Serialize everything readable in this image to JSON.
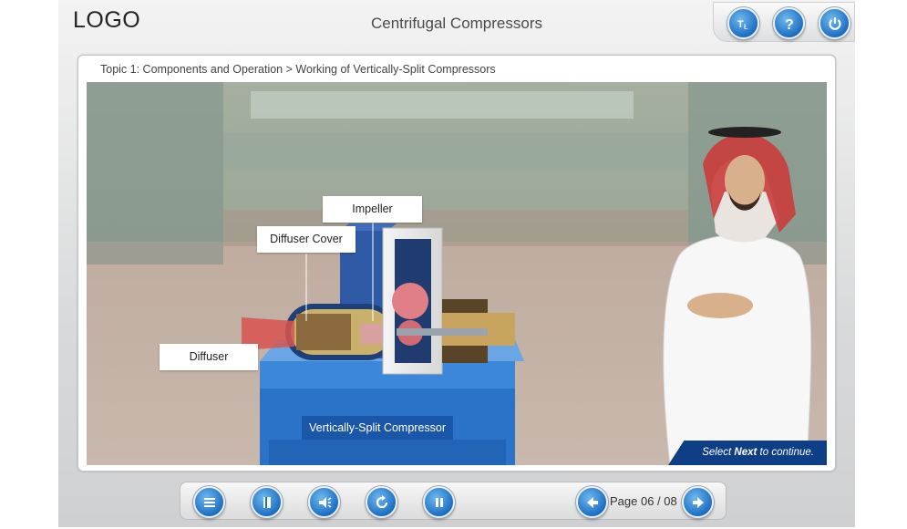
{
  "header": {
    "logo_text": "LOGO",
    "title": "Centrifugal Compressors",
    "buttons": [
      {
        "name": "glossary",
        "icon": "glossary-icon"
      },
      {
        "name": "help",
        "icon": "help-icon"
      },
      {
        "name": "exit",
        "icon": "power-icon"
      }
    ]
  },
  "content": {
    "breadcrumb": "Topic 1: Components and Operation > Working of Vertically-Split Compressors",
    "labels": {
      "impeller": "Impeller",
      "diffuser_cover": "Diffuser Cover",
      "diffuser": "Diffuser",
      "compressor": "Vertically-Split Compressor"
    },
    "continue": {
      "prefix": "Select ",
      "bold": "Next",
      "suffix": " to continue."
    }
  },
  "footer": {
    "buttons": [
      "menu-icon",
      "notes-icon",
      "audio-icon",
      "replay-icon",
      "pause-icon"
    ],
    "page_label": "Page 06 / 08",
    "prev_icon": "arrow-left-icon",
    "next_icon": "arrow-right-icon"
  },
  "colors": {
    "accent_blue": "#1d6fc2",
    "continue_banner": "#0e3f86",
    "base_blue": "#2a73c9"
  }
}
